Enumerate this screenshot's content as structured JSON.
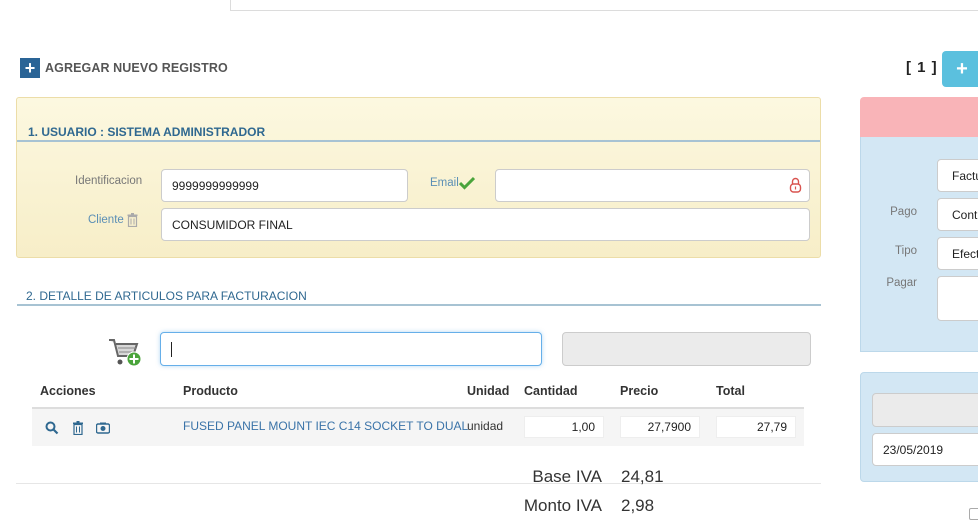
{
  "header": {
    "add_label": "AGREGAR NUEVO REGISTRO",
    "pager": "[ 1 ]",
    "pager_button": "+"
  },
  "section1": {
    "title": "1. USUARIO : SISTEMA ADMINISTRADOR",
    "identificacion_label": "Identificacion",
    "identificacion_value": "9999999999999",
    "email_label": "Email",
    "email_value": "",
    "cliente_label": "Cliente",
    "cliente_value": "CONSUMIDOR FINAL"
  },
  "section2": {
    "title": "2. DETALLE DE ARTICULOS PARA FACTURACION",
    "search_value": "",
    "columns": [
      "Acciones",
      "Producto",
      "Unidad",
      "Cantidad",
      "Precio",
      "Total"
    ],
    "rows": [
      {
        "producto": "FUSED PANEL MOUNT IEC C14 SOCKET TO DUAL",
        "unidad": "unidad",
        "cantidad": "1,00",
        "precio": "27,7900",
        "total": "27,79"
      }
    ]
  },
  "totals": {
    "base_iva_label": "Base IVA",
    "base_iva_value": "24,81",
    "monto_iva_label": "Monto IVA",
    "monto_iva_value": "2,98"
  },
  "right_panel": {
    "doc_value": "Factu",
    "pago_label": "Pago",
    "pago_value": "Cont",
    "tipo_label": "Tipo",
    "tipo_value": "Efect",
    "pagar_label": "Pagar",
    "pagar_value": "",
    "date_value": "23/05/2019"
  },
  "icons": {
    "add": "plus-icon",
    "email_ok": "checkmark-icon",
    "lock": "lock-icon",
    "trash": "trash-icon",
    "cart": "cart-add-icon",
    "search": "search-icon",
    "camera": "camera-icon"
  },
  "colors": {
    "accent": "#2a6496",
    "section_title": "#2f6890",
    "panel_yellow": "#fcf8e0",
    "panel_blue": "#d3e7f4",
    "panel_pink": "#f9b4b8",
    "pager_button": "#5bc0de",
    "check_green": "#4aa43b",
    "lock_red": "#d9534f"
  }
}
